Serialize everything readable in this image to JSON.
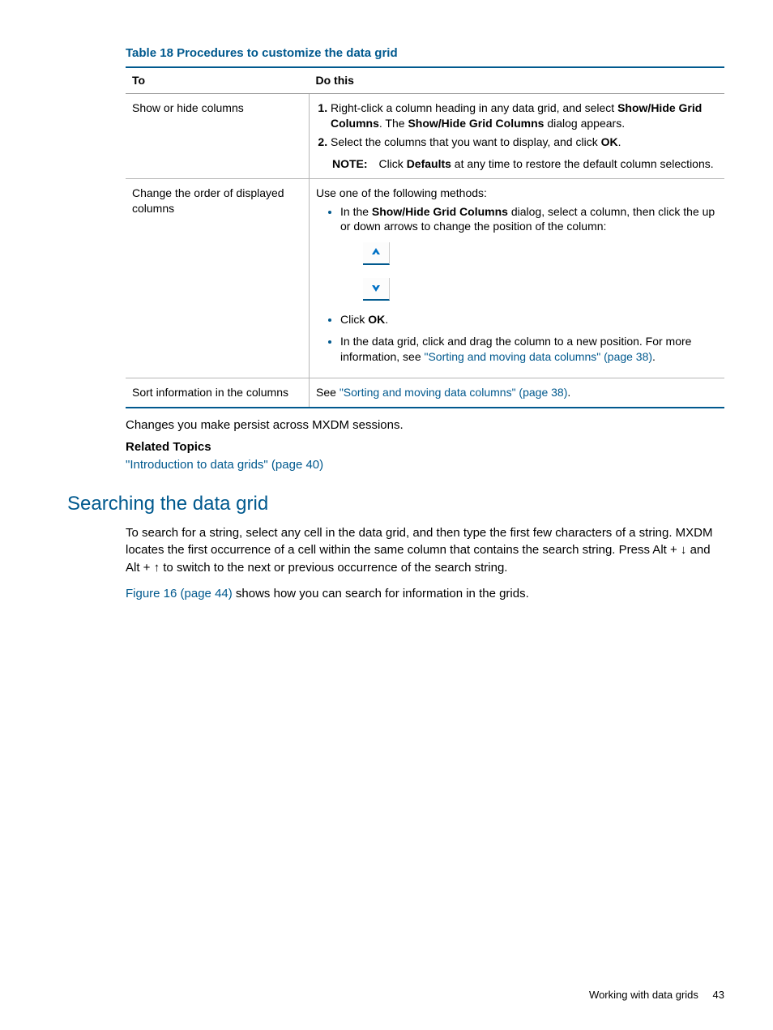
{
  "table": {
    "title": "Table 18 Procedures to customize the data grid",
    "head": {
      "to": "To",
      "dothis": "Do this"
    },
    "rows": {
      "r1": {
        "to": "Show or hide columns",
        "step1_a": "Right-click a column heading in any data grid, and select ",
        "step1_bold1": "Show/Hide Grid Columns",
        "step1_b": ". The ",
        "step1_bold2": "Show/Hide Grid Columns",
        "step1_c": " dialog appears.",
        "step2_a": "Select the columns that you want to display, and click ",
        "step2_ok": "OK",
        "step2_b": ".",
        "note_label": "NOTE:",
        "note_a": "Click ",
        "note_bold": "Defaults",
        "note_b": " at any time to restore the default column selections."
      },
      "r2": {
        "to": "Change the order of displayed columns",
        "intro": "Use one of the following methods:",
        "b1_a": "In the ",
        "b1_bold": "Show/Hide Grid Columns",
        "b1_b": " dialog, select a column, then click the up or down arrows to change the position of the column:",
        "b2_a": "Click ",
        "b2_ok": "OK",
        "b2_b": ".",
        "b3_a": "In the data grid, click and drag the column to a new position. For more information, see ",
        "b3_link": "\"Sorting and moving data columns\" (page 38)",
        "b3_b": "."
      },
      "r3": {
        "to": "Sort information in the columns",
        "a": "See ",
        "link": "\"Sorting and moving data columns\" (page 38)",
        "b": "."
      }
    }
  },
  "persist": "Changes you make persist across MXDM sessions.",
  "related": {
    "heading": "Related Topics",
    "link": "\"Introduction to data grids\" (page 40)"
  },
  "section": {
    "heading": "Searching the data grid",
    "p1": "To search for a string, select any cell in the data grid, and then type the first few characters of a string. MXDM locates the first occurrence of a cell within the same column that contains the search string. Press Alt + ↓ and Alt + ↑ to switch to the next or previous occurrence of the search string.",
    "p2_link": "Figure 16 (page 44)",
    "p2_rest": " shows how you can search for information in the grids."
  },
  "footer": {
    "label": "Working with data grids",
    "page": "43"
  }
}
